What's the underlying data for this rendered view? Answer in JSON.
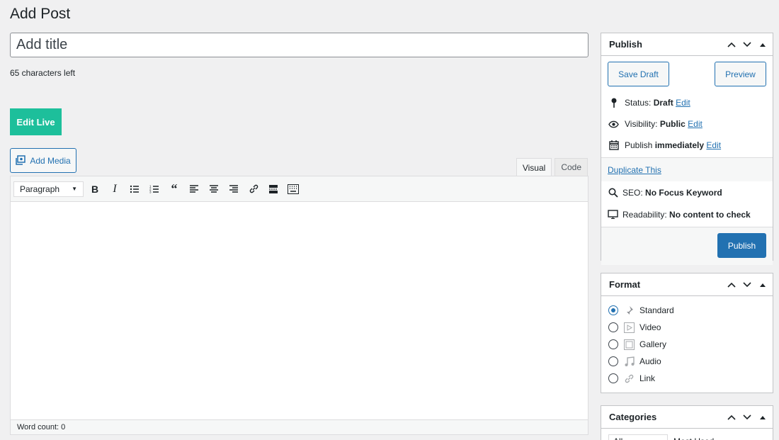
{
  "page_title": "Add Post",
  "title_input": {
    "placeholder": "Add title",
    "value": ""
  },
  "characters_left": "65 characters left",
  "edit_live_label": "Edit Live",
  "add_media_label": "Add Media",
  "editor": {
    "tabs": [
      {
        "label": "Visual",
        "active": true
      },
      {
        "label": "Code",
        "active": false
      }
    ],
    "format_select": "Paragraph",
    "toolbar_icons": [
      "bold-icon",
      "italic-icon",
      "bulleted-list-icon",
      "numbered-list-icon",
      "blockquote-icon",
      "align-left-icon",
      "align-center-icon",
      "align-right-icon",
      "link-icon",
      "read-more-icon",
      "toolbar-toggle-icon"
    ],
    "word_count": "Word count: 0"
  },
  "publish_box": {
    "title": "Publish",
    "save_draft_label": "Save Draft",
    "preview_label": "Preview",
    "status_label": "Status:",
    "status_value": "Draft",
    "visibility_label": "Visibility:",
    "visibility_value": "Public",
    "publish_label": "Publish",
    "publish_value": "immediately",
    "edit_label": "Edit",
    "duplicate_label": "Duplicate This",
    "seo_label": "SEO:",
    "seo_value": "No Focus Keyword",
    "readability_label": "Readability:",
    "readability_value": "No content to check",
    "publish_button_label": "Publish"
  },
  "format_box": {
    "title": "Format",
    "options": [
      {
        "label": "Standard",
        "icon": "pin-icon",
        "checked": true
      },
      {
        "label": "Video",
        "icon": "video-icon",
        "checked": false
      },
      {
        "label": "Gallery",
        "icon": "gallery-icon",
        "checked": false
      },
      {
        "label": "Audio",
        "icon": "audio-icon",
        "checked": false
      },
      {
        "label": "Link",
        "icon": "link-icon",
        "checked": false
      }
    ]
  },
  "categories_box": {
    "title": "Categories",
    "tabs": [
      "All Categories",
      "Most Used"
    ]
  },
  "colors": {
    "accent": "#2271b1",
    "edit_live": "#1dbf9b",
    "background": "#f0f0f1"
  }
}
